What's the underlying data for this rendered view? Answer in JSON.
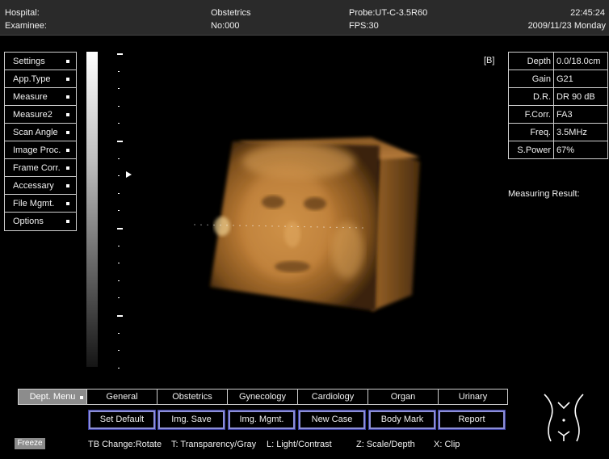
{
  "header": {
    "hospital": "Hospital:",
    "examinee": "Examinee:",
    "department": "Obstetrics",
    "patient_no": "No:000",
    "probe": "Probe:UT-C-3.5R60",
    "fps": "FPS:30",
    "time": "22:45:24",
    "date": "2009/11/23 Monday"
  },
  "left_menu": [
    {
      "label": "Settings"
    },
    {
      "label": "App.Type"
    },
    {
      "label": "Measure"
    },
    {
      "label": "Measure2"
    },
    {
      "label": "Scan Angle"
    },
    {
      "label": "Image Proc."
    },
    {
      "label": "Frame Corr."
    },
    {
      "label": "Accessary"
    },
    {
      "label": "File Mgmt."
    },
    {
      "label": "Options"
    }
  ],
  "mode_label": "[B]",
  "params": [
    {
      "label": "Depth",
      "value": "0.0/18.0cm"
    },
    {
      "label": "Gain",
      "value": "G21"
    },
    {
      "label": "D.R.",
      "value": "DR 90 dB"
    },
    {
      "label": "F.Corr.",
      "value": "FA3"
    },
    {
      "label": "Freq.",
      "value": "3.5MHz"
    },
    {
      "label": "S.Power",
      "value": "67%"
    }
  ],
  "measuring_result": "Measuring Result:",
  "dept_tabs": [
    {
      "label": "Dept. Menu"
    },
    {
      "label": "General"
    },
    {
      "label": "Obstetrics"
    },
    {
      "label": "Gynecology"
    },
    {
      "label": "Cardiology"
    },
    {
      "label": "Organ"
    },
    {
      "label": "Urinary"
    }
  ],
  "actions": [
    {
      "label": "Set Default"
    },
    {
      "label": "Img. Save"
    },
    {
      "label": "Img. Mgmt."
    },
    {
      "label": "New Case"
    },
    {
      "label": "Body Mark"
    },
    {
      "label": "Report"
    }
  ],
  "freeze": "Freeze",
  "hints": {
    "tb": "TB Change:Rotate",
    "t": "T: Transparency/Gray",
    "l": "L: Light/Contrast",
    "z": "Z: Scale/Depth",
    "x": "X: Clip"
  },
  "colors": {
    "render_tone": "#c9883a",
    "button_border": "#8d8fd6",
    "dept_tab_bg": "#8c8c8c"
  }
}
